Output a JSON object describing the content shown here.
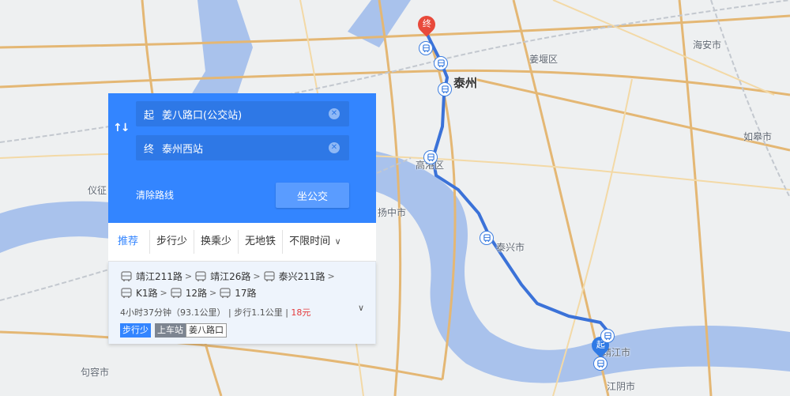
{
  "map": {
    "labels": {
      "haian": "海安市",
      "jiangyan": "姜堰区",
      "taizhou": "泰州",
      "rugao": "如皋市",
      "gaogang": "高港区",
      "yizheng": "仪征",
      "yangzhong": "扬中市",
      "taixing": "泰兴市",
      "jingjiang": "靖江市",
      "jurong": "句容市",
      "jiangyin": "江阴市"
    },
    "end_pin": "终",
    "start_pin": "起",
    "colors": {
      "route": "#3b72d8",
      "river": "#a9c2ec",
      "road": "#e4b774"
    }
  },
  "panel": {
    "start": {
      "prefix": "起",
      "value": "姜八路口(公交站)"
    },
    "end": {
      "prefix": "终",
      "value": "泰州西站"
    },
    "clear_route": "清除路线",
    "bus_button": "坐公交",
    "tabs": [
      "推荐",
      "步行少",
      "换乘少",
      "无地铁",
      "不限时间"
    ],
    "result": {
      "row1": [
        "靖江211路",
        "靖江26路",
        "泰兴211路"
      ],
      "row2": [
        "K1路",
        "12路",
        "17路"
      ],
      "duration": "4小时37分钟（93.1公里）",
      "walk": "步行1.1公里",
      "price": "18元",
      "badge_walk": "步行少",
      "badge_board": "上车站",
      "board_stop": "姜八路口"
    }
  }
}
